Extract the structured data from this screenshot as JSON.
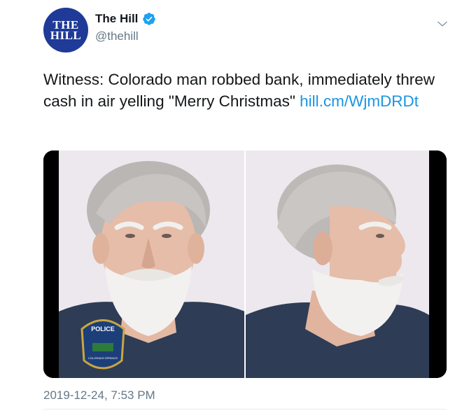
{
  "account": {
    "avatar_text_line1": "THE",
    "avatar_text_line2": "HILL",
    "display_name": "The Hill",
    "handle": "@thehill",
    "verified": true,
    "avatar_color": "#1f3a97"
  },
  "tweet": {
    "text": "Witness: Colorado man robbed bank, immediately threw cash in air yelling \"Merry Christmas\" ",
    "link": "hill.cm/WjmDRDt",
    "timestamp": "2019-12-24, 7:53 PM"
  },
  "media": {
    "badge_text": "POLICE",
    "badge_subtext": "COLORADO SPRINGS",
    "photos": [
      "front-view",
      "side-profile"
    ]
  },
  "colors": {
    "link": "#1b95e0",
    "secondary_text": "#657786",
    "verified": "#1da1f2"
  },
  "icons": {
    "menu": "chevron-down-icon",
    "verified": "verified-badge-icon"
  }
}
